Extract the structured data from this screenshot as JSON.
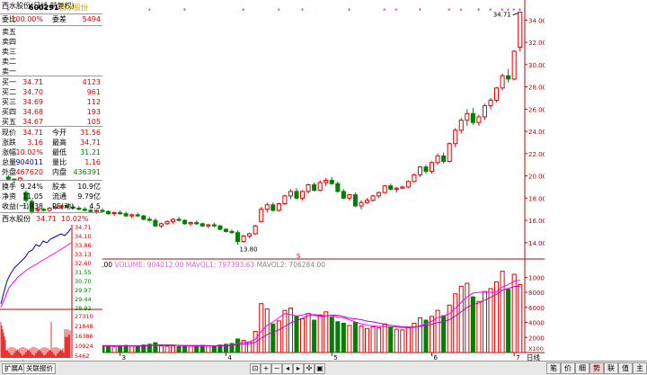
{
  "header": {
    "title": "西水股份(日线 前复权)"
  },
  "price_axis": {
    "ticks": [
      "34.00",
      "32.00",
      "30.00",
      "28.00",
      "26.00",
      "24.00",
      "22.00",
      "20.00",
      "18.00",
      "16.00",
      "14.00"
    ]
  },
  "vol_axis": {
    "ticks": [
      "10000",
      "8000",
      "6000",
      "4000",
      "2000"
    ],
    "unit": "X100"
  },
  "annotations": {
    "high": "34.71",
    "low": "13.80",
    "s_marker": "S"
  },
  "indicator": {
    "name": "VOL-TDX(5,10)",
    "vvol": "VVOL: 904012.00",
    "volume": "VOLUME: 904012.00",
    "mavol1": "MAVOL1: 797393.63",
    "mavol2": "MAVOL2: 706284.00"
  },
  "date_axis": {
    "labels": [
      "2017年",
      "3",
      "4",
      "5",
      "6",
      "7"
    ],
    "daily": "日线"
  },
  "bottom": {
    "tabs": [
      "扩展A",
      "关联报价"
    ]
  },
  "side": {
    "code": "600291",
    "name": "西水股份",
    "weibi": {
      "label": "委比",
      "value": "100.00%",
      "label2": "委差",
      "value2": "5494"
    },
    "sell": [
      {
        "label": "卖五",
        "price": "",
        "vol": ""
      },
      {
        "label": "卖四",
        "price": "",
        "vol": ""
      },
      {
        "label": "卖三",
        "price": "",
        "vol": ""
      },
      {
        "label": "卖二",
        "price": "",
        "vol": ""
      },
      {
        "label": "卖一",
        "price": "",
        "vol": ""
      }
    ],
    "buy": [
      {
        "label": "买一",
        "price": "34.71",
        "vol": "4123"
      },
      {
        "label": "买二",
        "price": "34.70",
        "vol": "961"
      },
      {
        "label": "买三",
        "price": "34.69",
        "vol": "112"
      },
      {
        "label": "买四",
        "price": "34.68",
        "vol": "193"
      },
      {
        "label": "买五",
        "price": "34.67",
        "vol": "105"
      }
    ],
    "stats": [
      {
        "l1": "现价",
        "v1": "34.71",
        "c1": "red",
        "l2": "今开",
        "v2": "31.56",
        "c2": "red"
      },
      {
        "l1": "涨跌",
        "v1": "3.16",
        "c1": "red",
        "l2": "最高",
        "v2": "34.71",
        "c2": "red"
      },
      {
        "l1": "涨幅",
        "v1": "10.02%",
        "c1": "red",
        "l2": "最低",
        "v2": "31.21",
        "c2": "green"
      },
      {
        "l1": "总量",
        "v1": "904011",
        "c1": "blue",
        "l2": "量比",
        "v2": "1.16",
        "c2": "red"
      },
      {
        "l1": "外盘",
        "v1": "467620",
        "c1": "red",
        "l2": "内盘",
        "v2": "436391",
        "c2": "green"
      }
    ],
    "stats2": [
      {
        "l1": "换手",
        "v1": "9.24%",
        "l2": "股本",
        "v2": "10.9亿"
      },
      {
        "l1": "净资",
        "v1": "11.05",
        "l2": "流通",
        "v2": "9.79亿"
      },
      {
        "l1": "收益(一)",
        "v1": "1.938",
        "l2": "PE(动)",
        "v2": "4.5"
      }
    ],
    "mini": {
      "name": "西水股份",
      "price": "34.71",
      "pct": "10.02%",
      "ticks": [
        "34.71",
        "34.10",
        "33.86",
        "33.13",
        "32.60",
        "31.55",
        "30.70",
        "29.97",
        "29.44",
        "28.92"
      ],
      "vol_ticks": [
        "27310",
        "21848",
        "16386",
        "10924",
        "5462"
      ]
    },
    "tabs": [
      "笔",
      "价",
      "细",
      "势",
      "联",
      "值",
      "主"
    ]
  },
  "chart_data": {
    "type": "candlestick",
    "title": "西水股份(日线 前复权)",
    "y_range": [
      13.5,
      35.0
    ],
    "vol_range": [
      0,
      11000
    ],
    "x_labels": [
      "2017年",
      "3",
      "4",
      "5",
      "6",
      "7"
    ],
    "ohlc": [
      [
        19.9,
        20.1,
        19.6,
        19.7
      ],
      [
        19.7,
        19.8,
        19.4,
        19.6
      ],
      [
        19.6,
        19.9,
        19.5,
        19.8
      ],
      [
        18.5,
        18.7,
        17.6,
        17.8
      ],
      [
        17.7,
        17.9,
        16.6,
        16.8
      ],
      [
        16.9,
        17.2,
        16.7,
        17.0
      ],
      [
        17.0,
        17.1,
        16.8,
        16.9
      ],
      [
        16.9,
        17.2,
        16.8,
        17.1
      ],
      [
        17.1,
        17.3,
        17.0,
        17.2
      ],
      [
        17.2,
        17.4,
        17.0,
        17.3
      ],
      [
        17.3,
        17.5,
        17.1,
        17.2
      ],
      [
        17.2,
        17.4,
        17.0,
        17.1
      ],
      [
        17.1,
        17.3,
        16.9,
        17.0
      ],
      [
        17.0,
        17.2,
        16.8,
        16.9
      ],
      [
        16.9,
        17.1,
        16.7,
        16.8
      ],
      [
        16.8,
        17.0,
        16.6,
        16.9
      ],
      [
        16.9,
        17.1,
        16.7,
        16.8
      ],
      [
        16.8,
        16.9,
        16.5,
        16.6
      ],
      [
        16.6,
        16.8,
        16.4,
        16.7
      ],
      [
        16.7,
        16.9,
        16.5,
        16.6
      ],
      [
        16.6,
        16.8,
        16.3,
        16.4
      ],
      [
        16.4,
        16.6,
        16.2,
        16.5
      ],
      [
        16.5,
        16.7,
        16.3,
        16.4
      ],
      [
        16.4,
        16.5,
        16.0,
        16.1
      ],
      [
        16.1,
        16.3,
        15.9,
        16.0
      ],
      [
        16.0,
        16.2,
        15.4,
        15.5
      ],
      [
        15.5,
        15.8,
        15.3,
        15.7
      ],
      [
        15.7,
        16.0,
        15.6,
        15.9
      ],
      [
        15.9,
        16.2,
        15.7,
        16.1
      ],
      [
        16.1,
        16.3,
        15.9,
        16.0
      ],
      [
        16.0,
        16.1,
        15.6,
        15.7
      ],
      [
        15.7,
        15.9,
        15.5,
        15.8
      ],
      [
        15.8,
        16.0,
        15.6,
        15.7
      ],
      [
        15.7,
        15.8,
        15.4,
        15.5
      ],
      [
        15.5,
        15.7,
        15.3,
        15.6
      ],
      [
        15.6,
        15.8,
        15.4,
        15.5
      ],
      [
        15.5,
        15.6,
        15.1,
        15.2
      ],
      [
        15.2,
        15.3,
        14.9,
        15.0
      ],
      [
        15.0,
        15.2,
        14.8,
        14.9
      ],
      [
        14.9,
        15.1,
        13.8,
        14.1
      ],
      [
        14.1,
        14.7,
        14.0,
        14.6
      ],
      [
        14.6,
        14.9,
        14.4,
        14.8
      ],
      [
        14.8,
        15.6,
        14.7,
        15.5
      ],
      [
        15.9,
        17.2,
        15.8,
        17.0
      ],
      [
        17.0,
        17.6,
        16.7,
        17.4
      ],
      [
        17.4,
        17.6,
        16.8,
        16.9
      ],
      [
        16.9,
        17.6,
        16.8,
        17.5
      ],
      [
        17.5,
        18.3,
        17.4,
        18.2
      ],
      [
        18.2,
        18.8,
        17.9,
        18.6
      ],
      [
        18.6,
        18.9,
        17.9,
        18.0
      ],
      [
        18.0,
        18.7,
        17.8,
        18.6
      ],
      [
        18.6,
        19.3,
        18.4,
        19.2
      ],
      [
        19.2,
        19.4,
        18.6,
        18.7
      ],
      [
        18.7,
        19.6,
        18.6,
        19.4
      ],
      [
        19.4,
        19.8,
        19.1,
        19.6
      ],
      [
        19.6,
        19.9,
        19.2,
        19.3
      ],
      [
        19.3,
        19.5,
        18.5,
        18.6
      ],
      [
        18.6,
        18.8,
        17.9,
        18.0
      ],
      [
        18.0,
        18.4,
        17.8,
        18.3
      ],
      [
        18.3,
        18.5,
        17.2,
        17.3
      ],
      [
        17.3,
        17.8,
        17.0,
        17.6
      ],
      [
        17.6,
        18.0,
        17.5,
        17.8
      ],
      [
        17.8,
        18.3,
        17.7,
        18.2
      ],
      [
        18.2,
        18.6,
        18.0,
        18.5
      ],
      [
        18.5,
        19.2,
        18.4,
        19.1
      ],
      [
        19.1,
        19.3,
        18.7,
        18.8
      ],
      [
        18.8,
        19.0,
        18.5,
        18.9
      ],
      [
        18.9,
        19.1,
        18.8,
        19.0
      ],
      [
        19.0,
        19.6,
        18.9,
        19.5
      ],
      [
        19.5,
        20.2,
        19.4,
        20.1
      ],
      [
        20.1,
        20.9,
        19.9,
        20.8
      ],
      [
        20.8,
        21.0,
        20.2,
        20.4
      ],
      [
        20.4,
        21.3,
        20.2,
        21.2
      ],
      [
        21.2,
        22.0,
        21.0,
        21.8
      ],
      [
        21.8,
        22.1,
        21.1,
        21.3
      ],
      [
        21.3,
        23.0,
        21.2,
        22.9
      ],
      [
        22.9,
        24.3,
        22.6,
        24.1
      ],
      [
        24.1,
        25.2,
        23.8,
        25.0
      ],
      [
        25.0,
        26.0,
        24.5,
        25.6
      ],
      [
        25.6,
        26.1,
        24.6,
        24.8
      ],
      [
        24.8,
        25.5,
        24.5,
        25.3
      ],
      [
        25.3,
        26.5,
        25.0,
        26.3
      ],
      [
        26.3,
        27.0,
        26.0,
        26.8
      ],
      [
        26.8,
        28.0,
        26.6,
        27.9
      ],
      [
        27.9,
        29.2,
        27.7,
        29.0
      ],
      [
        29.0,
        29.6,
        28.4,
        28.7
      ],
      [
        28.7,
        31.3,
        28.6,
        31.2
      ],
      [
        31.56,
        34.71,
        31.21,
        34.71
      ]
    ],
    "volume": [
      1200,
      900,
      850,
      2100,
      1800,
      1300,
      1100,
      1000,
      950,
      900,
      1100,
      1000,
      900,
      950,
      850,
      800,
      900,
      850,
      800,
      900,
      950,
      900,
      850,
      1000,
      1100,
      1300,
      900,
      850,
      900,
      800,
      850,
      900,
      800,
      950,
      900,
      850,
      1000,
      1100,
      1200,
      1800,
      1600,
      1400,
      2800,
      6500,
      5800,
      3800,
      4200,
      5600,
      5900,
      4800,
      4500,
      5200,
      4300,
      5000,
      5400,
      4700,
      4100,
      3900,
      3600,
      4000,
      3500,
      3200,
      3400,
      3300,
      3800,
      3400,
      3100,
      3000,
      3300,
      3900,
      4600,
      4300,
      4800,
      5600,
      4900,
      6300,
      7800,
      8800,
      9200,
      7400,
      6800,
      8100,
      8500,
      9400,
      10800,
      8400,
      10400,
      9040
    ],
    "volume_up": [
      false,
      false,
      true,
      false,
      false,
      true,
      false,
      true,
      true,
      true,
      false,
      false,
      false,
      false,
      false,
      true,
      false,
      false,
      true,
      false,
      false,
      true,
      false,
      false,
      false,
      false,
      true,
      true,
      true,
      false,
      false,
      true,
      false,
      false,
      true,
      false,
      false,
      false,
      false,
      false,
      true,
      true,
      true,
      true,
      true,
      false,
      true,
      true,
      true,
      false,
      true,
      true,
      false,
      true,
      true,
      false,
      false,
      false,
      true,
      false,
      true,
      true,
      true,
      true,
      true,
      false,
      true,
      true,
      true,
      true,
      true,
      false,
      true,
      true,
      false,
      true,
      true,
      true,
      true,
      false,
      true,
      true,
      true,
      true,
      true,
      false,
      true,
      true
    ]
  }
}
